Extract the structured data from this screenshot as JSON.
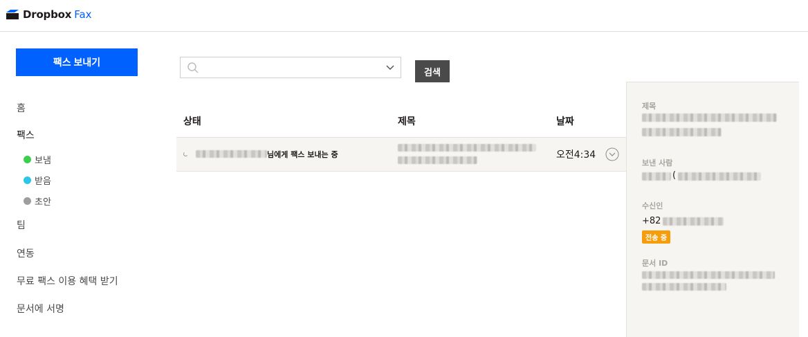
{
  "brand": {
    "name": "Dropbox",
    "product": "Fax",
    "accent": "#0061fe"
  },
  "sidebar": {
    "send_label": "팩스 보내기",
    "items": [
      {
        "label": "홈"
      },
      {
        "label": "팩스"
      },
      {
        "label": "팀"
      },
      {
        "label": "연동"
      },
      {
        "label": "무료 팩스 이용 혜택 받기"
      },
      {
        "label": "문서에 서명"
      }
    ],
    "fax_folders": [
      {
        "label": "보냄",
        "color": "#3ccf4e"
      },
      {
        "label": "받음",
        "color": "#2ec6e6"
      },
      {
        "label": "초안",
        "color": "#9e9e9e"
      }
    ]
  },
  "search": {
    "placeholder": "",
    "button_label": "검색"
  },
  "table": {
    "headers": {
      "status": "상태",
      "subject": "제목",
      "date": "날짜"
    },
    "rows": [
      {
        "status_suffix": "님에게 팩스 보내는 중",
        "date": "오전4:34"
      }
    ]
  },
  "details": {
    "subject_label": "제목",
    "sender_label": "보낸 사람",
    "sender_paren": "(",
    "recipient_label": "수신인",
    "recipient_prefix": "+82",
    "status_badge": "전송 중",
    "badge_color": "#f59d0b",
    "doc_id_label": "문서 ID"
  }
}
